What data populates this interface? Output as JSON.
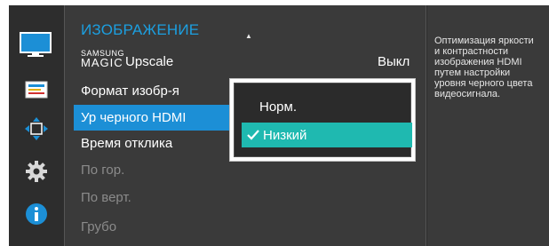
{
  "menu": {
    "title": "ИЗОБРАЖЕНИЕ",
    "items": [
      {
        "brand_top": "SAMSUNG",
        "brand_bottom": "MAGIC",
        "label": "Upscale",
        "value": "Выкл"
      },
      {
        "label": "Формат изобр-я"
      },
      {
        "label": "Ур черного HDMI"
      },
      {
        "label": "Время отклика"
      },
      {
        "label": "По гор."
      },
      {
        "label": "По верт."
      },
      {
        "label": "Грубо"
      }
    ]
  },
  "dropdown": {
    "options": [
      {
        "label": "Норм."
      },
      {
        "label": "Низкий"
      }
    ]
  },
  "description": "Оптимизация яркости\nи контрастности\nизображения HDMI\nпутем настройки\nуровня черного цвета\nвидеосигнала.",
  "sidebar": {
    "icons": [
      "picture-icon",
      "onscreen-display-icon",
      "position-icon",
      "settings-gear-icon",
      "info-icon"
    ]
  },
  "colors": {
    "accent_blue": "#1c8fd6",
    "title_blue": "#1c9fe0",
    "selected_option": "#1fb9b0"
  }
}
